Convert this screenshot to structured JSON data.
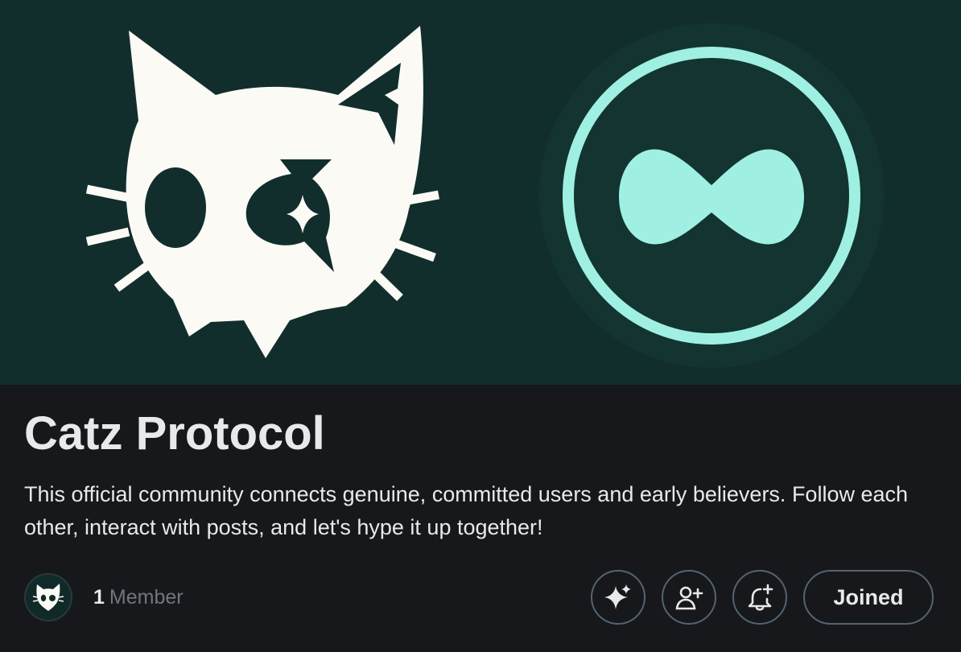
{
  "community": {
    "title": "Catz Protocol",
    "description": "This official community connects genuine, committed users and early believers. Follow each other, interact with posts, and let's hype it up together!",
    "member_count": "1",
    "member_label": "Member"
  },
  "actions": {
    "joined_label": "Joined",
    "buttons": [
      "sparkle-icon",
      "add-person-icon",
      "bell-plus-icon"
    ]
  },
  "colors": {
    "banner_bg": "#112e2c",
    "page_bg": "#16181c",
    "cat_logo": "#fbfaf5",
    "ring_accent": "#9ff0e2",
    "muted_text": "#71767b",
    "button_border": "#536471"
  }
}
